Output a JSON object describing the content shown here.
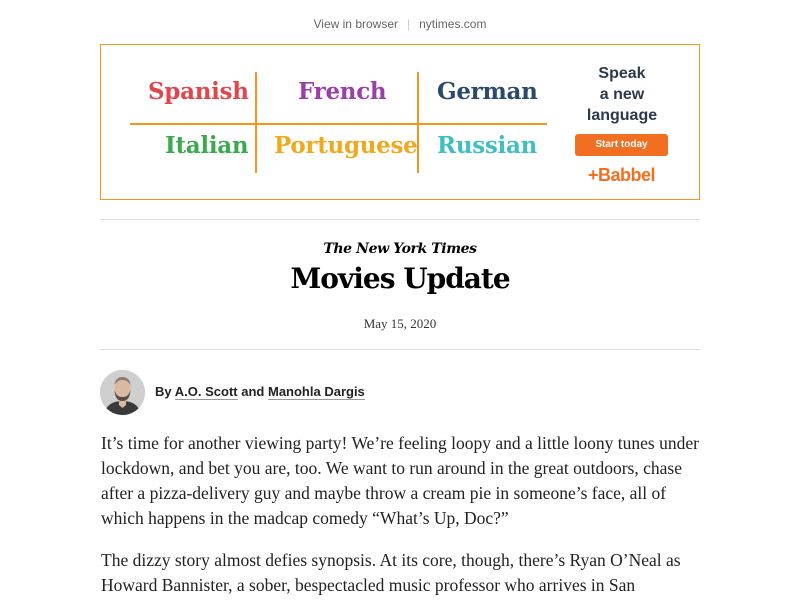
{
  "topbar": {
    "view_in_browser": "View in browser",
    "separator": "|",
    "site": "nytimes.com"
  },
  "ad": {
    "languages": [
      {
        "label": "Spanish",
        "color": "#e0474c"
      },
      {
        "label": "French",
        "color": "#9b3fa8"
      },
      {
        "label": "German",
        "color": "#2b4a6b"
      },
      {
        "label": "Italian",
        "color": "#3aaa4f"
      },
      {
        "label": "Portuguese",
        "color": "#f0a81c"
      },
      {
        "label": "Russian",
        "color": "#3fbfbf"
      }
    ],
    "headline": [
      "Speak",
      "a new",
      "language"
    ],
    "cta": "Start today",
    "brand": "+Babbel",
    "accent_color": "#f7941d",
    "button_color": "#f26f21"
  },
  "newsletter": {
    "masthead": "The New York Times",
    "title": "Movies Update",
    "date": "May 15, 2020"
  },
  "byline": {
    "prefix": "By",
    "author1": "A.O. Scott",
    "conjunction": "and",
    "author2": "Manohla Dargis"
  },
  "body": {
    "p1": "It’s time for another viewing party! We’re feeling loopy and a little loony tunes under lockdown, and bet you are, too. We want to run around in the great outdoors, chase after a pizza-delivery guy and maybe throw a cream pie in someone’s face, all of which happens in the madcap comedy “What’s Up, Doc?”",
    "p2": "The dizzy story almost defies synopsis. At its core, though, there’s Ryan O’Neal as Howard Bannister, a sober, bespectacled music professor who arrives in San"
  }
}
